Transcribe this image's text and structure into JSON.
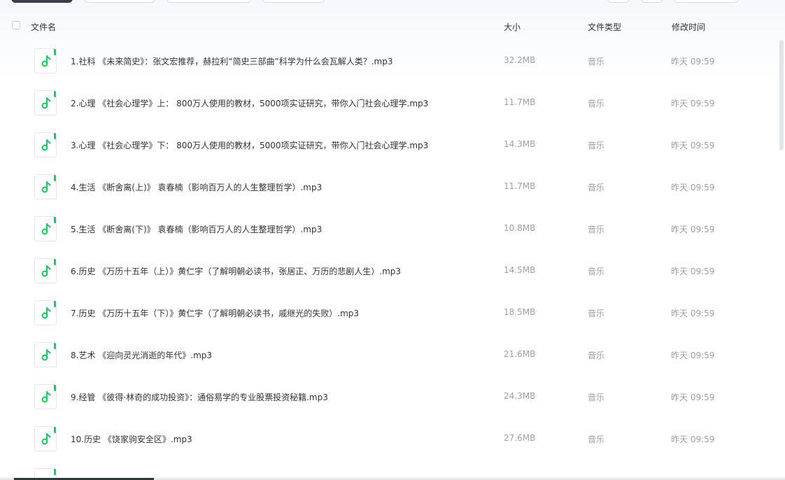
{
  "header": {
    "name_label": "文件名",
    "size_label": "大小",
    "type_label": "文件类型",
    "time_label": "修改时间"
  },
  "colors": {
    "accent": "#2fc069",
    "text": "#333333",
    "muted": "#9a9fa8"
  },
  "files": [
    {
      "name": "1.社科 《未来简史》：张文宏推荐，赫拉利“简史三部曲”科学为什么会瓦解人类？.mp3",
      "size": "32.2MB",
      "type": "音乐",
      "modified": "昨天 09:59",
      "icon": "music-note-icon"
    },
    {
      "name": "2.心理 《社会心理学》上： 800万人使用的教材，5000项实证研究，带你入门社会心理学.mp3",
      "size": "11.7MB",
      "type": "音乐",
      "modified": "昨天 09:59",
      "icon": "music-note-icon"
    },
    {
      "name": "3.心理 《社会心理学》下： 800万人使用的教材，5000项实证研究，带你入门社会心理学.mp3",
      "size": "14.3MB",
      "type": "音乐",
      "modified": "昨天 09:59",
      "icon": "music-note-icon"
    },
    {
      "name": "4.生活 《断舍离(上)》 袁春楠（影响百万人的人生整理哲学）.mp3",
      "size": "11.7MB",
      "type": "音乐",
      "modified": "昨天 09:59",
      "icon": "music-note-icon"
    },
    {
      "name": "5.生活 《断舍离(下)》 袁春楠（影响百万人的人生整理哲学）.mp3",
      "size": "10.8MB",
      "type": "音乐",
      "modified": "昨天 09:59",
      "icon": "music-note-icon"
    },
    {
      "name": "6.历史 《万历十五年（上）》黄仁宇（了解明朝必读书，张居正、万历的悲剧人生）.mp3",
      "size": "14.5MB",
      "type": "音乐",
      "modified": "昨天 09:59",
      "icon": "music-note-icon"
    },
    {
      "name": "7.历史 《万历十五年（下）》黄仁宇（了解明朝必读书，戚继光的失败）.mp3",
      "size": "18.5MB",
      "type": "音乐",
      "modified": "昨天 09:59",
      "icon": "music-note-icon"
    },
    {
      "name": "8.艺术 《迎向灵光消逝的年代》.mp3",
      "size": "21.6MB",
      "type": "音乐",
      "modified": "昨天 09:59",
      "icon": "music-note-icon"
    },
    {
      "name": "9.经管 《彼得·林奇的成功投资》：通俗易学的专业股票投资秘籍.mp3",
      "size": "24.3MB",
      "type": "音乐",
      "modified": "昨天 09:59",
      "icon": "music-note-icon"
    },
    {
      "name": "10.历史 《饶家驹安全区》.mp3",
      "size": "27.6MB",
      "type": "音乐",
      "modified": "昨天 09:59",
      "icon": "music-note-icon"
    }
  ]
}
